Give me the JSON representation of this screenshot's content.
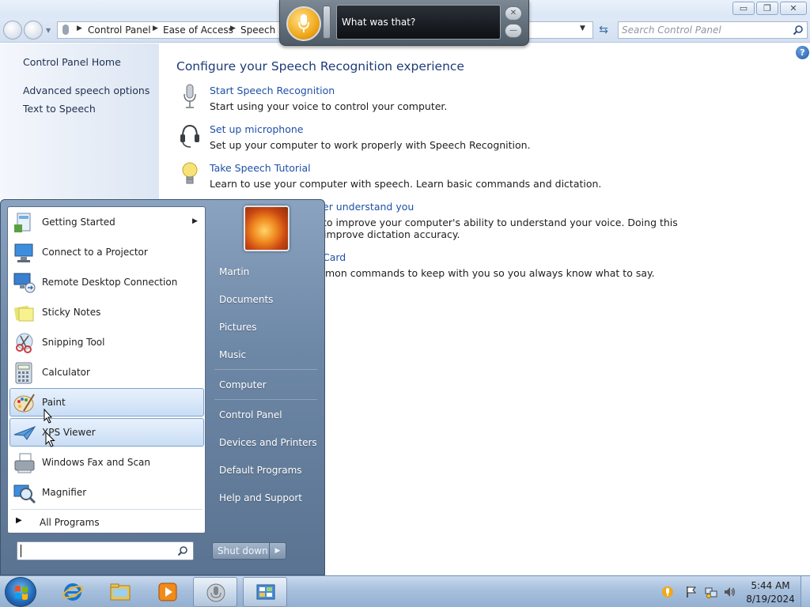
{
  "window": {
    "caption_buttons": {
      "minimize": "▭",
      "maximize": "❐",
      "close": "✕"
    },
    "address": {
      "crumbs": [
        "Control Panel",
        "Ease of Access",
        "Speech Recognition"
      ]
    },
    "search_placeholder": "Search Control Panel",
    "sidebar": {
      "home": "Control Panel Home",
      "links": [
        "Advanced speech options",
        "Text to Speech"
      ]
    },
    "content": {
      "title": "Configure your Speech Recognition experience",
      "tasks": [
        {
          "link": "Start Speech Recognition",
          "desc": "Start using your voice to control your computer.",
          "icon": "microphone-icon"
        },
        {
          "link": "Set up microphone",
          "desc": "Set up your computer to work properly with Speech Recognition.",
          "icon": "headset-icon"
        },
        {
          "link": "Take Speech Tutorial",
          "desc": "Learn to use your computer with speech.  Learn basic commands and dictation.",
          "icon": "lightbulb-icon"
        },
        {
          "link": "er understand you",
          "desc": " to improve your computer's ability to understand your voice.  Doing this",
          "desc2": " improve dictation accuracy.",
          "icon": ""
        },
        {
          "link": " Card",
          "desc": "mon commands to keep with you so you always know what to say.",
          "icon": ""
        }
      ]
    }
  },
  "speech_widget": {
    "text": "What was that?"
  },
  "start_menu": {
    "programs": [
      {
        "label": "Getting Started",
        "icon": "getting-started-icon",
        "has_submenu": true
      },
      {
        "label": "Connect to a Projector",
        "icon": "projector-icon"
      },
      {
        "label": "Remote Desktop Connection",
        "icon": "remote-desktop-icon"
      },
      {
        "label": "Sticky Notes",
        "icon": "sticky-notes-icon"
      },
      {
        "label": "Snipping Tool",
        "icon": "snipping-tool-icon"
      },
      {
        "label": "Calculator",
        "icon": "calculator-icon"
      },
      {
        "label": "Paint",
        "icon": "paint-icon",
        "highlighted": true
      },
      {
        "label": "XPS Viewer",
        "icon": "xps-viewer-icon",
        "highlighted": true
      },
      {
        "label": "Windows Fax and Scan",
        "icon": "fax-scan-icon"
      },
      {
        "label": "Magnifier",
        "icon": "magnifier-icon"
      }
    ],
    "all_programs": "All Programs",
    "right_items": [
      "Martin",
      "Documents",
      "Pictures",
      "Music",
      "Computer",
      "Control Panel",
      "Devices and Printers",
      "Default Programs",
      "Help and Support"
    ],
    "shutdown": "Shut down"
  },
  "taskbar": {
    "time": "5:44 AM",
    "date": "8/19/2024"
  }
}
